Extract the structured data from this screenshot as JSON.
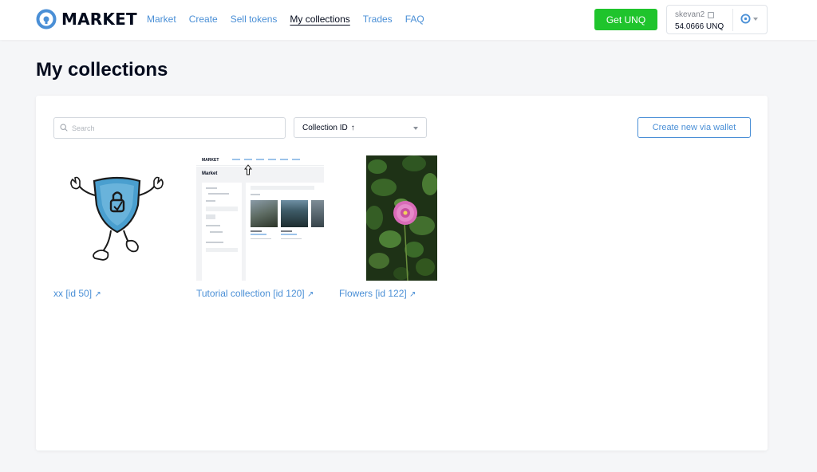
{
  "header": {
    "logo_text": "MARKET",
    "nav": [
      {
        "label": "Market",
        "active": false
      },
      {
        "label": "Create",
        "active": false
      },
      {
        "label": "Sell tokens",
        "active": false
      },
      {
        "label": "My collections",
        "active": true
      },
      {
        "label": "Trades",
        "active": false
      },
      {
        "label": "FAQ",
        "active": false
      }
    ],
    "get_unq_label": "Get UNQ",
    "account": {
      "name": "skevan2",
      "balance": "54.0666 UNQ"
    }
  },
  "page": {
    "title": "My collections"
  },
  "toolbar": {
    "search_placeholder": "Search",
    "search_value": "",
    "sort_label": "Collection ID",
    "sort_arrow": "↑",
    "create_label": "Create new via wallet"
  },
  "collections": [
    {
      "label": "xx [id 50]",
      "ext": "↗",
      "image": "shield-mascot-icon"
    },
    {
      "label": "Tutorial collection [id 120]",
      "ext": "↗",
      "image": "market-screenshot-thumbnail"
    },
    {
      "label": "Flowers [id 122]",
      "ext": "↗",
      "image": "pink-flower-photo"
    }
  ],
  "tutorial_thumb": {
    "logo": "MARKET",
    "title": "Market"
  },
  "colors": {
    "accent": "#4a8fd6",
    "green": "#1fc42c",
    "text": "#040b1d"
  }
}
